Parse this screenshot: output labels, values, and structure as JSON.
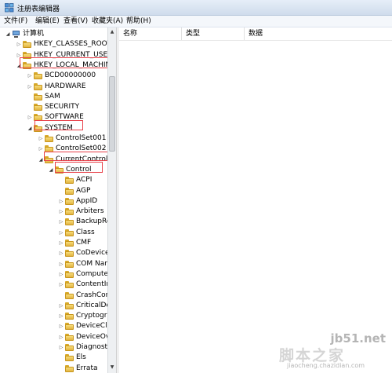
{
  "window": {
    "title": "注册表编辑器"
  },
  "menu": [
    "文件(F)",
    "编辑(E)",
    "查看(V)",
    "收藏夹(A)",
    "帮助(H)"
  ],
  "tree": {
    "computer": "计算机",
    "root_keys": [
      "HKEY_CLASSES_ROOT",
      "HKEY_CURRENT_USER",
      "HKEY_LOCAL_MACHINE"
    ],
    "hklm_children": [
      "BCD00000000",
      "HARDWARE",
      "SAM",
      "SECURITY",
      "SOFTWARE",
      "SYSTEM"
    ],
    "system_children": [
      "ControlSet001",
      "ControlSet002",
      "CurrentControlSe"
    ],
    "ccs_children": [
      "Control"
    ],
    "control_children": [
      "ACPI",
      "AGP",
      "AppID",
      "Arbiters",
      "BackupRe",
      "Class",
      "CMF",
      "CoDevicel",
      "COM Nan",
      "Computer",
      "ContentIn",
      "CrashCon",
      "CriticalDe",
      "Cryptogra",
      "DeviceCla",
      "DeviceOve",
      "Diagnostic",
      "Els",
      "Errata"
    ]
  },
  "columns": {
    "name": "名称",
    "type": "类型",
    "data": "数据"
  },
  "watermark": {
    "site": "jb51.net",
    "cn": "脚本之家",
    "url": "jiaocheng.chazidian.com"
  },
  "colors": {
    "highlight": "#e8414a",
    "folder": "#e2b440"
  }
}
